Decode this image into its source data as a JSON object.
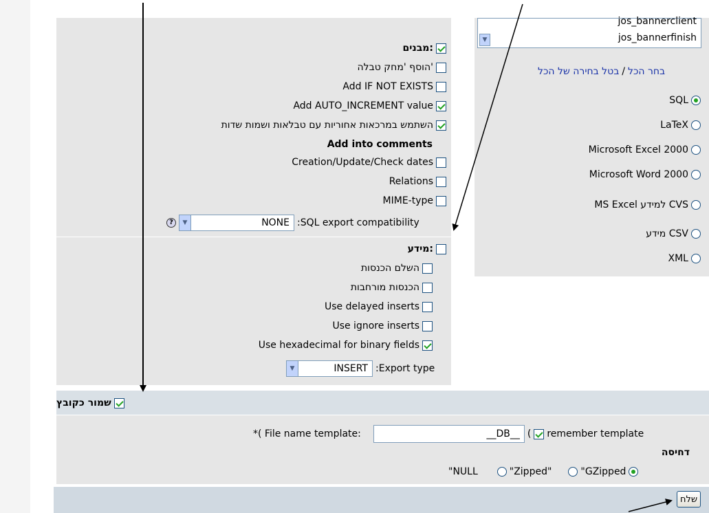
{
  "tables": {
    "items": [
      "jos_bannerclient",
      "jos_bannerfinish"
    ]
  },
  "selection": {
    "select_all": "בחר הכל",
    "separator": "/",
    "deselect_all": "בטל בחירה של הכל"
  },
  "formats": [
    {
      "label": "SQL",
      "selected": true
    },
    {
      "label": "LaTeX",
      "selected": false
    },
    {
      "label": "Microsoft Excel 2000",
      "selected": false
    },
    {
      "label": "Microsoft Word 2000",
      "selected": false
    },
    {
      "label": "MS Excel למידע CVS",
      "selected": false
    },
    {
      "label": "מידע CSV",
      "selected": false
    },
    {
      "label": "XML",
      "selected": false
    }
  ],
  "structure": {
    "header": "מבנים:",
    "add_drop_table": "הוסף 'מחק טבלה'",
    "add_if_not_exists": "Add IF NOT EXISTS",
    "add_auto_increment": "Add AUTO_INCREMENT value",
    "backquotes": "השתמש במרכאות אחוריות עם טבלאות ושמות שדות",
    "comments_header": "Add into comments",
    "creation_dates": "Creation/Update/Check dates",
    "relations": "Relations",
    "mime_type": "MIME-type",
    "compat_label": ":SQL export compatibility",
    "compat_value": "NONE",
    "help_icon": "?"
  },
  "data_section": {
    "header": "מידע:",
    "complete_inserts": "השלם הכנסות",
    "extended_inserts": "הכנסות מורחבות",
    "delayed_inserts": "Use delayed inserts",
    "ignore_inserts": "Use ignore inserts",
    "hex_binary": "Use hexadecimal for binary fields",
    "export_type_label": ":Export type",
    "export_type_value": "INSERT"
  },
  "save": {
    "header": "שמור כקובץ",
    "template_label": "*( File name template:",
    "template_value": "__DB__",
    "paren": "(",
    "remember_label": "remember template",
    "compression_label": "דחיסה",
    "none_option": "\"NULL",
    "zipped_option": "\"Zipped\"",
    "gzipped_option": "\"GZipped"
  },
  "submit": {
    "label": "שלח"
  },
  "colors": {
    "accent_check": "#21a121",
    "panel": "#e6e6e6",
    "save_header": "#d9e0e6",
    "link": "#1a33a8"
  }
}
